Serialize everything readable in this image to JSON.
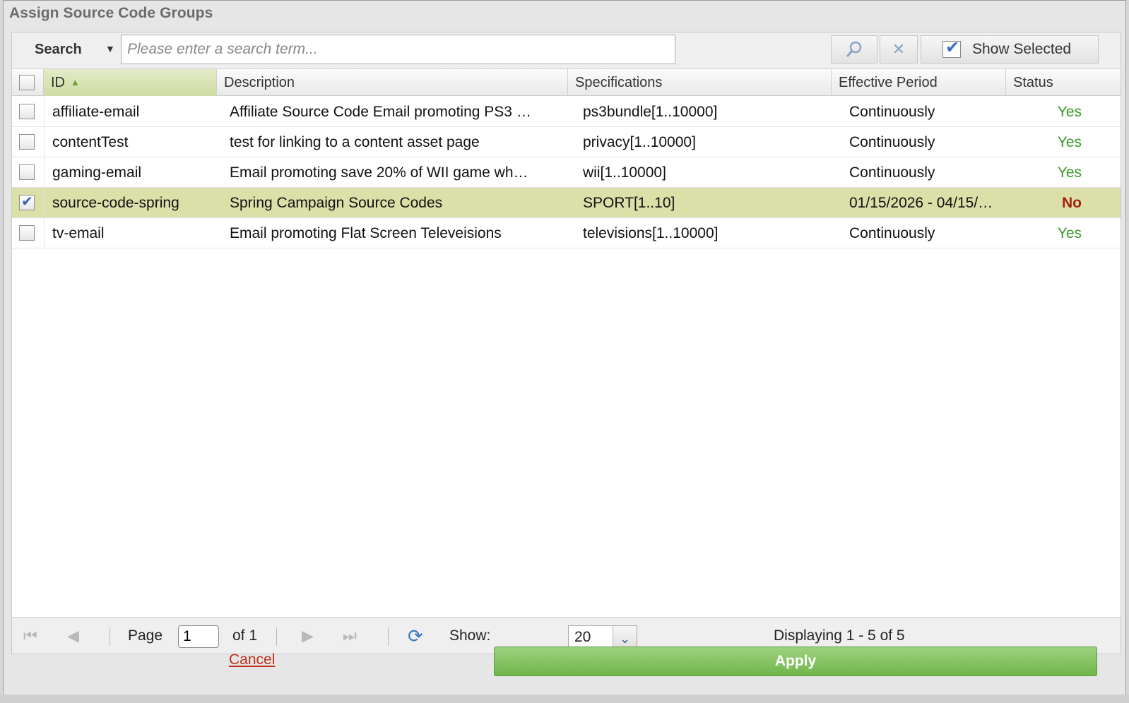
{
  "dialog": {
    "title": "Assign Source Code Groups"
  },
  "toolbar": {
    "search_label": "Search",
    "search_placeholder": "Please enter a search term...",
    "search_value": "",
    "show_selected_label": "Show Selected",
    "show_selected_checked": true
  },
  "grid": {
    "columns": [
      {
        "key": "id",
        "label": "ID",
        "sorted": "asc"
      },
      {
        "key": "description",
        "label": "Description"
      },
      {
        "key": "specifications",
        "label": "Specifications"
      },
      {
        "key": "effective_period",
        "label": "Effective Period"
      },
      {
        "key": "status",
        "label": "Status"
      }
    ],
    "rows": [
      {
        "id": "affiliate-email",
        "description": "Affiliate Source Code Email promoting PS3 …",
        "specifications": "ps3bundle[1..10000]",
        "effective_period": "Continuously",
        "status": "Yes",
        "checked": false
      },
      {
        "id": "contentTest",
        "description": "test for linking to a content asset page",
        "specifications": "privacy[1..10000]",
        "effective_period": "Continuously",
        "status": "Yes",
        "checked": false
      },
      {
        "id": "gaming-email",
        "description": "Email promoting save 20% of WII game wh…",
        "specifications": "wii[1..10000]",
        "effective_period": "Continuously",
        "status": "Yes",
        "checked": false
      },
      {
        "id": "source-code-spring",
        "description": "Spring Campaign Source Codes",
        "specifications": "SPORT[1..10]",
        "effective_period": "01/15/2026 - 04/15/…",
        "status": "No",
        "checked": true
      },
      {
        "id": "tv-email",
        "description": "Email promoting Flat Screen Televeisions",
        "specifications": "televisions[1..10000]",
        "effective_period": "Continuously",
        "status": "Yes",
        "checked": false
      }
    ]
  },
  "pager": {
    "page_label": "Page",
    "page_value": "1",
    "of_label": "of 1",
    "show_label": "Show:",
    "page_size": "20",
    "display_text": "Displaying 1 - 5 of 5"
  },
  "footer": {
    "cancel_label": "Cancel",
    "apply_label": "Apply"
  },
  "colors": {
    "selected_row": "#dbe0a9",
    "status_yes": "#3a9a2a",
    "status_no": "#a4220f",
    "apply_green": "#6fb64a"
  }
}
